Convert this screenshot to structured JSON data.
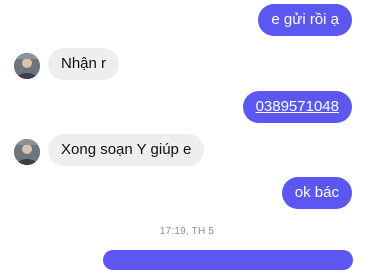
{
  "messages": [
    {
      "side": "out",
      "text": "e gửi rồi ạ"
    },
    {
      "side": "in",
      "text": "Nhận r"
    },
    {
      "side": "out",
      "text": "0389571048",
      "is_link": true
    },
    {
      "side": "in",
      "text": "Xong soạn Y giúp e"
    },
    {
      "side": "out",
      "text": "ok bác"
    }
  ],
  "timestamp": "17:19, TH 5",
  "colors": {
    "outgoing_bubble": "#5b57f0",
    "incoming_bubble": "#eeeef0",
    "timestamp": "#8e8e93"
  },
  "icons": {
    "contact_avatar": "user-avatar-icon"
  }
}
